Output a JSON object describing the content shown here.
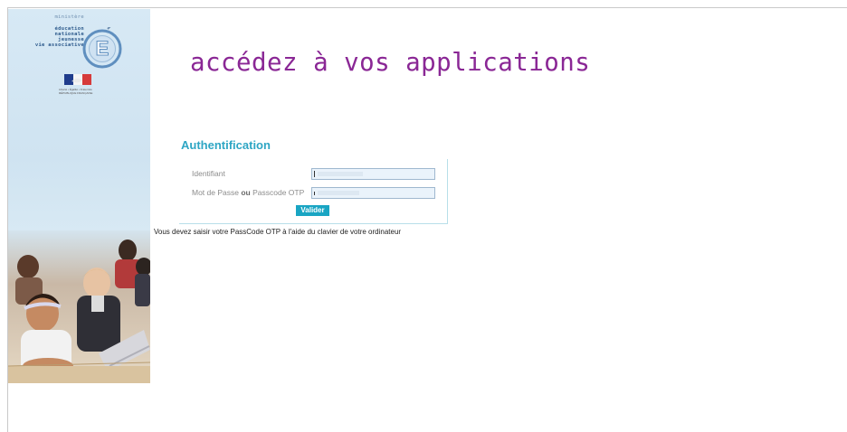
{
  "ministry": {
    "line1": "ministère",
    "line2": "éducation",
    "line3": "nationale",
    "line4": "jeunesse",
    "line5": "vie associative",
    "emblem_letter": "E",
    "flag_caption_line1": "Liberté • Égalité • Fraternité",
    "flag_caption_line2": "RÉPUBLIQUE FRANÇAISE"
  },
  "headline": "accédez à vos applications",
  "auth": {
    "title": "Authentification",
    "identifiant_label": "Identifiant",
    "password_label_part1": "Mot de Passe ",
    "password_label_or": "ou",
    "password_label_part2": " Passcode OTP",
    "identifiant_value": "",
    "password_value": "",
    "submit_label": "Valider",
    "note": "Vous devez saisir votre PassCode OTP à l'aide du clavier de votre ordinateur"
  },
  "colors": {
    "headline": "#8a2795",
    "accent": "#2ea6c4",
    "button": "#19a5c3"
  }
}
